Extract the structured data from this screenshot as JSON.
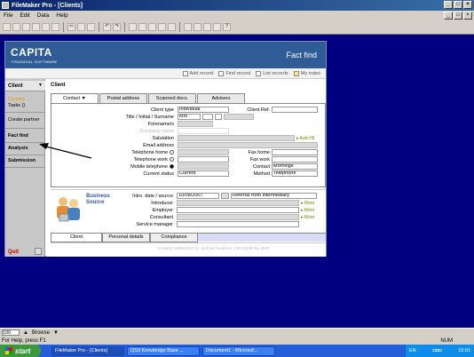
{
  "window": {
    "title": "FileMaker Pro - [Clients]"
  },
  "menu": [
    "File",
    "Edit",
    "Data",
    "Help"
  ],
  "header": {
    "logo": "CAPITA",
    "logo_sub": "FINANCIAL SOFTWARE",
    "section": "Fact find"
  },
  "actions": [
    {
      "label": "Add record",
      "icon": "add-icon"
    },
    {
      "label": "Find record",
      "icon": "find-icon"
    },
    {
      "label": "List records",
      "icon": "list-icon"
    },
    {
      "label": "My notes",
      "icon": "notes-icon"
    }
  ],
  "sidebar": {
    "client_label": "Client",
    "items": [
      {
        "label": "Contact",
        "color": "#e8a000"
      },
      {
        "label": "Tasks ()"
      },
      {
        "label": "Create partner"
      },
      {
        "label": "Fact find",
        "bold": true
      },
      {
        "label": "Analysis",
        "bold": true
      },
      {
        "label": "Submission",
        "bold": true
      }
    ],
    "quit": "Quit"
  },
  "main": {
    "section_label": "Client",
    "tabs": [
      "Contact",
      "Postal address",
      "Scanned docs.",
      "Advisers"
    ],
    "form": {
      "client_type": {
        "label": "Client type",
        "value": "Individual"
      },
      "client_ref": {
        "label": "Client Ref."
      },
      "title_initial_surname": {
        "label": "Title / Initial / Surname",
        "value": "Mrs"
      },
      "forenames": {
        "label": "Forename/s"
      },
      "company_name": {
        "label": "Company name"
      },
      "salutation": {
        "label": "Salutation",
        "auto_fill": "Auto fill"
      },
      "email": {
        "label": "Email address"
      },
      "tel_home": {
        "label": "Telephone home"
      },
      "tel_work": {
        "label": "Telephone work"
      },
      "mobile": {
        "label": "Mobile telephone"
      },
      "current_status": {
        "label": "Current status",
        "value": "Current"
      },
      "fax_home": {
        "label": "Fax home"
      },
      "fax_work": {
        "label": "Fax work"
      },
      "contact": {
        "label": "Contact",
        "value": "Mornings"
      },
      "method": {
        "label": "Method",
        "value": "Telephone"
      }
    },
    "business_source": {
      "title": "Business Source",
      "intro": {
        "label": "Intro. date / source",
        "date": "10/08/2007",
        "source": "Referral from intermediary"
      },
      "introducer": {
        "label": "Introducer",
        "more": "More"
      },
      "employer": {
        "label": "Employer",
        "more": "More"
      },
      "consultant": {
        "label": "Consultant",
        "more": "More"
      },
      "service_manager": {
        "label": "Service manager"
      }
    },
    "bottom_tabs": [
      "Client",
      "Personal details",
      "Compliance"
    ],
    "footer": "Created: 10/08/2007 by: and last modified: 24/07/2008 by: BUR"
  },
  "statusbar": {
    "zoom": "100",
    "mode": "Browse"
  },
  "help": {
    "text": "For Help, press F1",
    "num": "NUM"
  },
  "taskbar": {
    "start": "start",
    "items": [
      "FileMaker Pro - [Clients]",
      "QS3 Knowledge Base ...",
      "Document1 - Microsof..."
    ],
    "lang": "EN",
    "time": "15:01"
  }
}
